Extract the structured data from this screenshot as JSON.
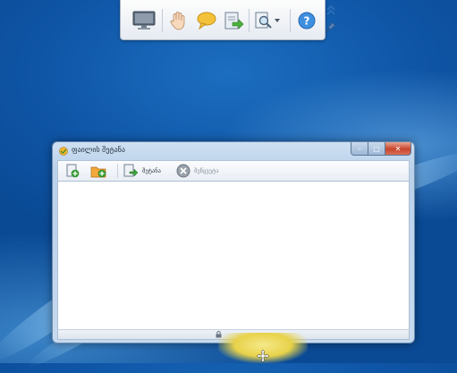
{
  "toolbar": {
    "items": [
      {
        "name": "screen",
        "icon": "monitor-icon"
      },
      {
        "name": "hand",
        "icon": "hand-icon"
      },
      {
        "name": "chat",
        "icon": "chat-bubble-icon"
      },
      {
        "name": "file-transfer",
        "icon": "file-transfer-icon"
      },
      {
        "name": "view",
        "icon": "zoom-document-icon"
      },
      {
        "name": "help",
        "icon": "help-icon"
      },
      {
        "name": "collapse",
        "icon": "double-chevron-up-icon"
      },
      {
        "name": "pin",
        "icon": "pin-icon"
      }
    ],
    "help_glyph": "?"
  },
  "window": {
    "title": "ფაილის შეტანა",
    "caption": {
      "min": "–",
      "max": "□",
      "close": "✕"
    },
    "commands": {
      "send_label": "შეტანა",
      "cancel_label": "შეწყვეტა"
    }
  },
  "colors": {
    "desktop": "#0f55a6",
    "window_frame": "#b9d1ea",
    "close_red": "#c9452d",
    "glow_yellow": "#e8d24a"
  }
}
